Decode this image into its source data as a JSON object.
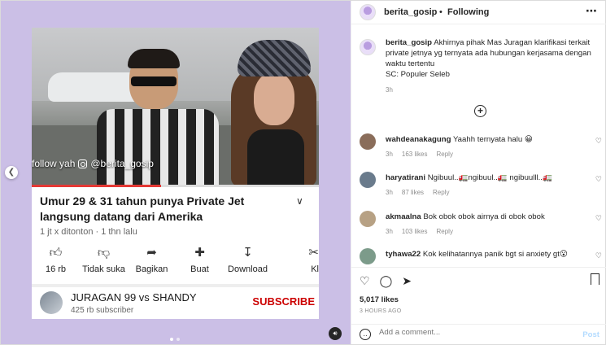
{
  "media": {
    "watermark": "follow yah",
    "watermark_handle": "@berita_gosip",
    "video_progress_fraction": 0.45,
    "video_title": "Umur 29 & 31 tahun punya Private Jet langsung datang dari Amerika",
    "video_meta": "1 jt x ditonton · 1 thn lalu",
    "actions": [
      {
        "icon": "thumbs-up-icon",
        "label": "16 rb"
      },
      {
        "icon": "thumbs-down-icon",
        "label": "Tidak suka"
      },
      {
        "icon": "share-icon",
        "label": "Bagikan"
      },
      {
        "icon": "remix-icon",
        "label": "Buat"
      },
      {
        "icon": "download-icon",
        "label": "Download"
      },
      {
        "icon": "clip-icon",
        "label": "Kl"
      }
    ],
    "channel_name": "JURAGAN 99 vs SHANDY",
    "channel_subs": "425 rb subscriber",
    "subscribe_label": "SUBSCRIBE",
    "carousel_index": 1,
    "carousel_count": 2
  },
  "header": {
    "username": "berita_gosip",
    "separator": "•",
    "follow_status": "Following",
    "more": "..."
  },
  "caption": {
    "username": "berita_gosip",
    "text": "Akhirnya pihak Mas Juragan klarifikasi terkait private jetnya yg ternyata ada hubungan kerjasama dengan waktu tertentu",
    "source": "SC: Populer Seleb",
    "time": "3h"
  },
  "comments": [
    {
      "username": "wahdeanakagung",
      "text": "Yaahh ternyata halu 😀",
      "time": "3h",
      "likes": "163 likes",
      "reply": "Reply",
      "avatar_color": "#8a6d5a"
    },
    {
      "username": "haryatirani",
      "text": "Ngibuul..🚛ngibuul..🚛 ngibuulll..🚛",
      "time": "3h",
      "likes": "87 likes",
      "reply": "Reply",
      "avatar_color": "#6a7b8c"
    },
    {
      "username": "akmaalna",
      "text": "Bok obok obok airnya di obok obok",
      "time": "3h",
      "likes": "103 likes",
      "reply": "Reply",
      "avatar_color": "#b7a184"
    },
    {
      "username": "tyhawa22",
      "text": "Kok kelihatannya panik bgt si anxiety gt😮",
      "time": "",
      "likes": "",
      "reply": "",
      "avatar_color": "#7c9b8a"
    }
  ],
  "footer": {
    "likes": "5,017 likes",
    "ago": "3 HOURS AGO",
    "add_comment_placeholder": "Add a comment...",
    "post_label": "Post"
  }
}
